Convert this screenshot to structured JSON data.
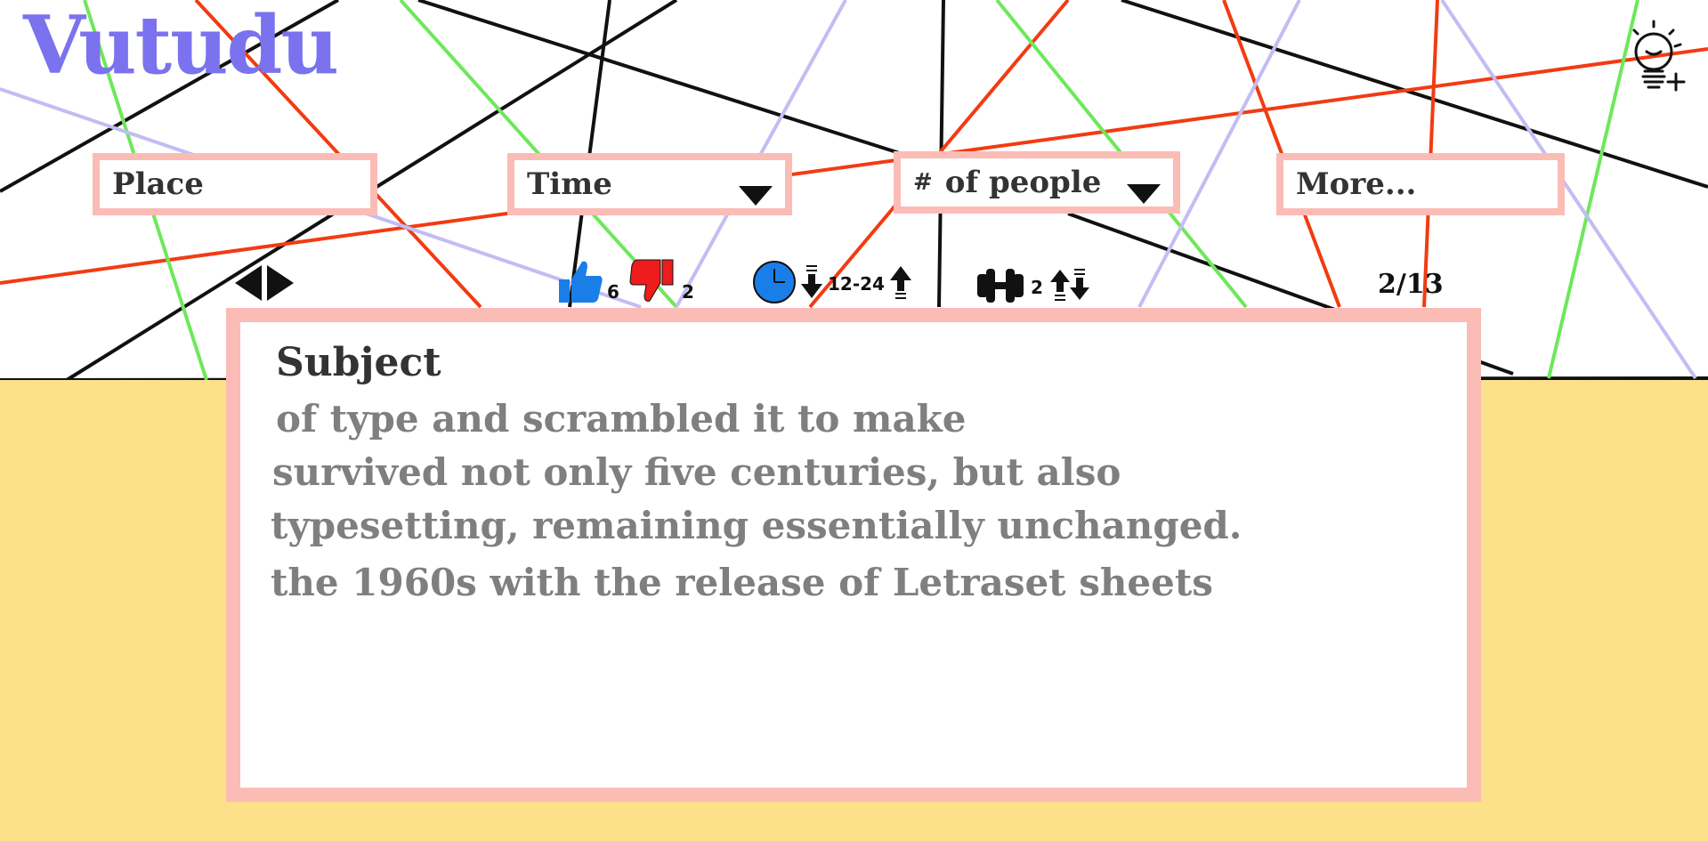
{
  "app": {
    "title": "Vutudu"
  },
  "filters": {
    "place": "Place",
    "time": "Time",
    "people_hash": "#",
    "people": "of people",
    "more": "More..."
  },
  "toolbar": {
    "likes": "6",
    "dislikes": "2",
    "age_range": "12-24",
    "players": "2",
    "page": "2/13"
  },
  "card": {
    "subject": "Subject",
    "lines": [
      "of type and scrambled it to make",
      "survived not only five centuries, but also",
      "typesetting, remaining essentially unchanged.",
      "the 1960s with the release of Letraset sheets"
    ]
  },
  "icons": {
    "logo_color": "#7a72ee",
    "border_color": "#fbbcb6",
    "bottom_color": "#fde08a",
    "thumb_up_color": "#1a7ee8",
    "thumb_down_color": "#ee1c1c",
    "clock_color": "#1a7ee8"
  }
}
